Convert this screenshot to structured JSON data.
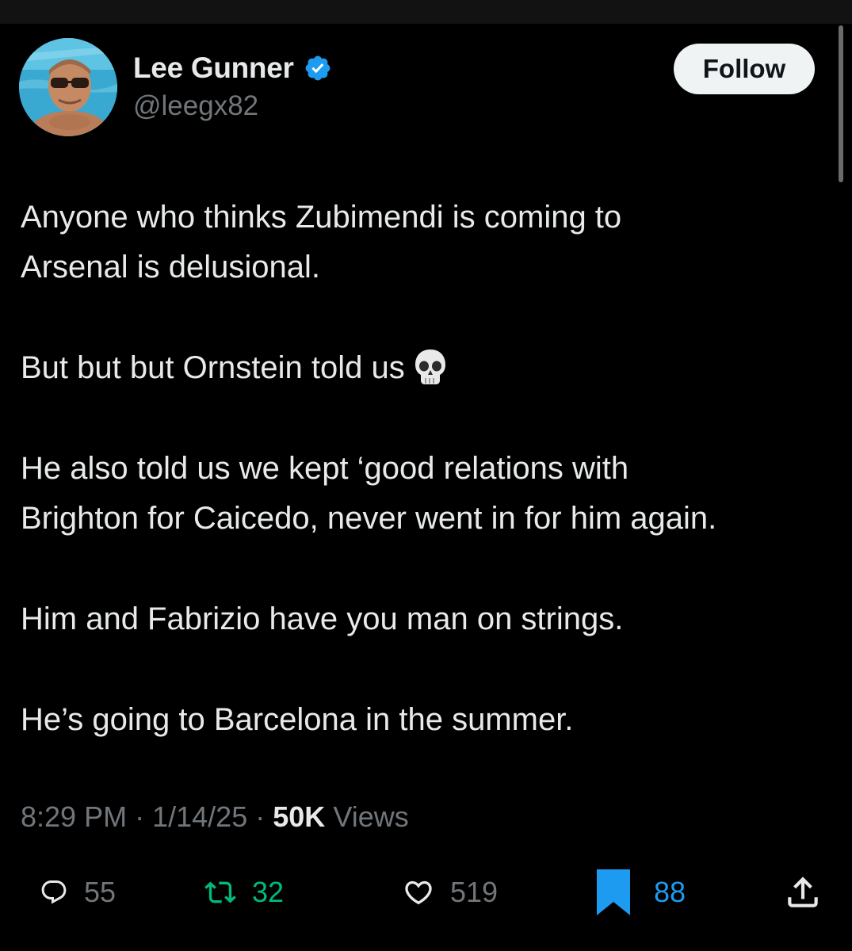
{
  "colors": {
    "background": "#000000",
    "text": "#e7e9ea",
    "secondary_text": "#71767b",
    "verified_badge": "#1d9bf0",
    "retweet_green": "#00ba7c",
    "bookmark_blue": "#1d9bf0",
    "follow_button_bg": "#eff3f4"
  },
  "author": {
    "name": "Lee Gunner",
    "handle": "@leegx82",
    "verified": true,
    "avatar_icon": "avatar-photo"
  },
  "follow_button": {
    "label": "Follow"
  },
  "tweet": {
    "paragraphs": [
      {
        "lines": [
          "Anyone who thinks Zubimendi is coming to",
          "Arsenal is delusional."
        ]
      },
      {
        "lines": [
          "But but but Ornstein told us"
        ],
        "emoji": "skull-emoji"
      },
      {
        "lines": [
          "He also told us we kept ‘good relations with",
          "Brighton for Caicedo, never went in for him again."
        ]
      },
      {
        "lines": [
          "Him and Fabrizio have you man on strings."
        ]
      },
      {
        "lines": [
          "He’s going to Barcelona in the summer."
        ]
      }
    ]
  },
  "meta": {
    "time": "8:29 PM",
    "separator": "·",
    "date": "1/14/25",
    "views_count": "50K",
    "views_label": "Views"
  },
  "actions": {
    "replies": "55",
    "retweets": "32",
    "likes": "519",
    "bookmarks": "88",
    "icons": [
      "reply-icon",
      "retweet-icon",
      "like-icon",
      "bookmark-icon",
      "share-icon"
    ]
  }
}
